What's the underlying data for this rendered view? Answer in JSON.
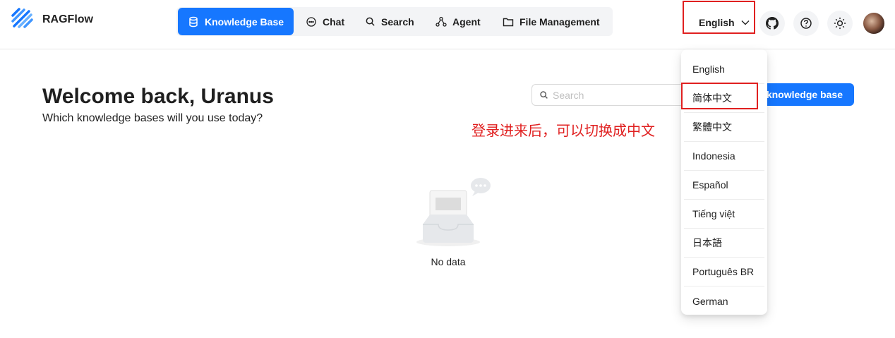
{
  "app": {
    "name": "RAGFlow"
  },
  "nav": {
    "items": [
      {
        "label": "Knowledge Base",
        "icon": "database-icon",
        "active": true
      },
      {
        "label": "Chat",
        "icon": "chat-bubble-icon",
        "active": false
      },
      {
        "label": "Search",
        "icon": "search-icon",
        "active": false
      },
      {
        "label": "Agent",
        "icon": "agent-graph-icon",
        "active": false
      },
      {
        "label": "File Management",
        "icon": "folder-icon",
        "active": false
      }
    ]
  },
  "header": {
    "language": "English",
    "icons": [
      "github-icon",
      "help-icon",
      "theme-sun-icon",
      "user-avatar"
    ]
  },
  "main": {
    "welcome": "Welcome back, Uranus",
    "subtitle": "Which knowledge bases will you use today?",
    "search_placeholder": "Search",
    "create_button": "knowledge base",
    "empty_text": "No data"
  },
  "annotation": "登录进来后，可以切换成中文",
  "language_menu": {
    "options": [
      "English",
      "简体中文",
      "繁體中文",
      "Indonesia",
      "Español",
      "Tiếng việt",
      "日本語",
      "Português BR",
      "German"
    ],
    "highlighted": "简体中文"
  },
  "colors": {
    "accent": "#1677ff",
    "highlight_box": "#e02020"
  }
}
